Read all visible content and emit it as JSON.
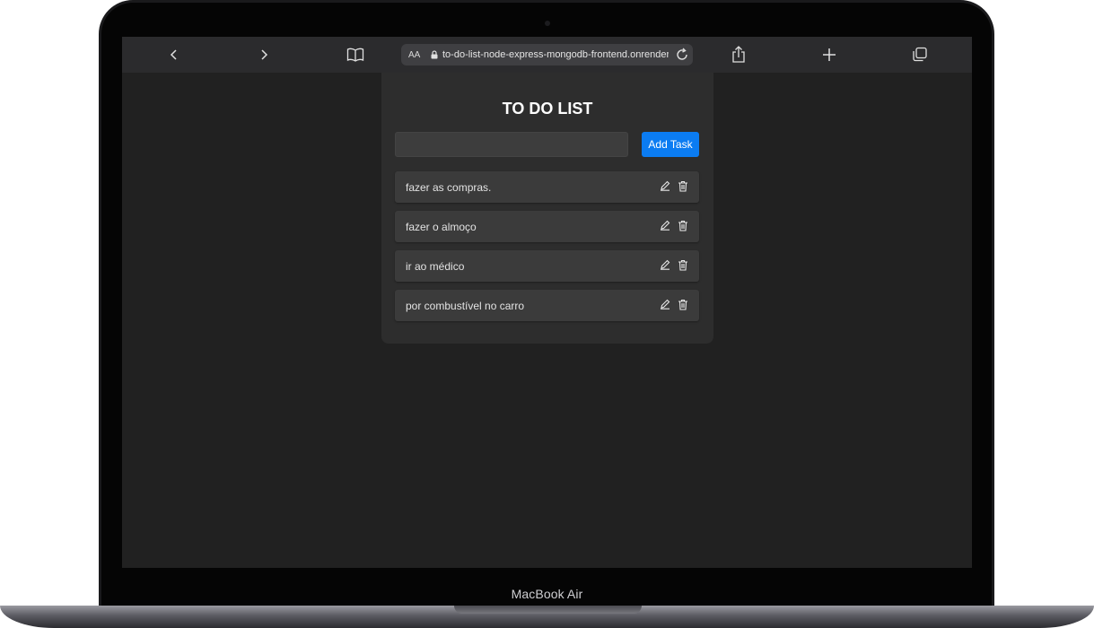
{
  "device": {
    "label": "MacBook Air"
  },
  "browser": {
    "text_size_label": "AA",
    "url": "to-do-list-node-express-mongodb-frontend.onrender.com",
    "icons": [
      "chevron-left-icon",
      "chevron-right-icon",
      "book-icon",
      "lock-icon",
      "reload-icon",
      "share-icon",
      "plus-icon",
      "tabs-icon"
    ]
  },
  "app": {
    "title": "TO DO LIST",
    "input_value": "",
    "add_button_label": "Add Task",
    "accent_color": "#0b7cf2",
    "tasks": [
      {
        "text": "fazer as compras."
      },
      {
        "text": "fazer o almoço"
      },
      {
        "text": "ir ao médico"
      },
      {
        "text": "por combustível no carro"
      }
    ],
    "task_icons": [
      "edit-icon",
      "trash-icon"
    ]
  }
}
